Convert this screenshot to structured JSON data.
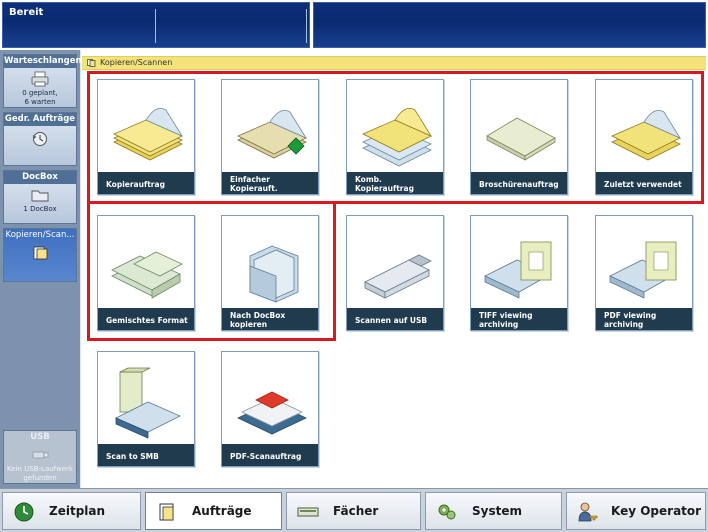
{
  "status": {
    "text": "Bereit"
  },
  "sidebar": {
    "items": [
      {
        "title": "Warteschlangen",
        "sub1": "0 geplant,",
        "sub2": "6 warten",
        "icon": "printer-icon"
      },
      {
        "title": "Gedr. Aufträge",
        "icon": "history-icon"
      },
      {
        "title": "DocBox",
        "sub1": "1 DocBox",
        "icon": "folder-icon"
      },
      {
        "title": "Kopieren/Scan...",
        "icon": "copy-scan-icon"
      },
      {
        "title": "USB",
        "sub1": "Kein USB-Laufwerk",
        "sub2": "gefunden",
        "icon": "usb-icon"
      }
    ]
  },
  "breadcrumb": {
    "text": "Kopieren/Scannen"
  },
  "tiles": [
    {
      "label": "Kopierauftrag",
      "icon": "copy-job-icon"
    },
    {
      "label": "Einfacher Kopierauft.",
      "icon": "simple-copy-icon"
    },
    {
      "label": "Komb. Kopierauftrag",
      "icon": "combined-copy-icon"
    },
    {
      "label": "Broschürenauftrag",
      "icon": "booklet-icon"
    },
    {
      "label": "Zuletzt verwendet",
      "icon": "recent-icon"
    },
    {
      "label": "Gemischtes Format",
      "icon": "mixed-format-icon"
    },
    {
      "label": "Nach DocBox kopieren",
      "icon": "docbox-copy-icon"
    },
    {
      "label": "Scannen auf USB",
      "icon": "usb-stick-icon"
    },
    {
      "label": "TIFF viewing archiving",
      "icon": "tiff-scan-icon"
    },
    {
      "label": "PDF viewing archiving",
      "icon": "pdf-scan-icon"
    },
    {
      "label": "Scan to SMB",
      "icon": "smb-scan-icon"
    },
    {
      "label": "PDF-Scanauftrag",
      "icon": "pdf-scanjob-icon"
    }
  ],
  "tabs": [
    {
      "label": "Zeitplan",
      "icon": "schedule-icon"
    },
    {
      "label": "Aufträge",
      "icon": "jobs-icon"
    },
    {
      "label": "Fächer",
      "icon": "trays-icon"
    },
    {
      "label": "System",
      "icon": "system-icon"
    },
    {
      "label": "Key Operator",
      "icon": "key-operator-icon"
    }
  ],
  "colors": {
    "highlight": "#d8191f",
    "tile_label_bg": "#1f3b4d",
    "breadcrumb_bg": "#f3e37a",
    "status_bg": "#0d2f7a"
  }
}
